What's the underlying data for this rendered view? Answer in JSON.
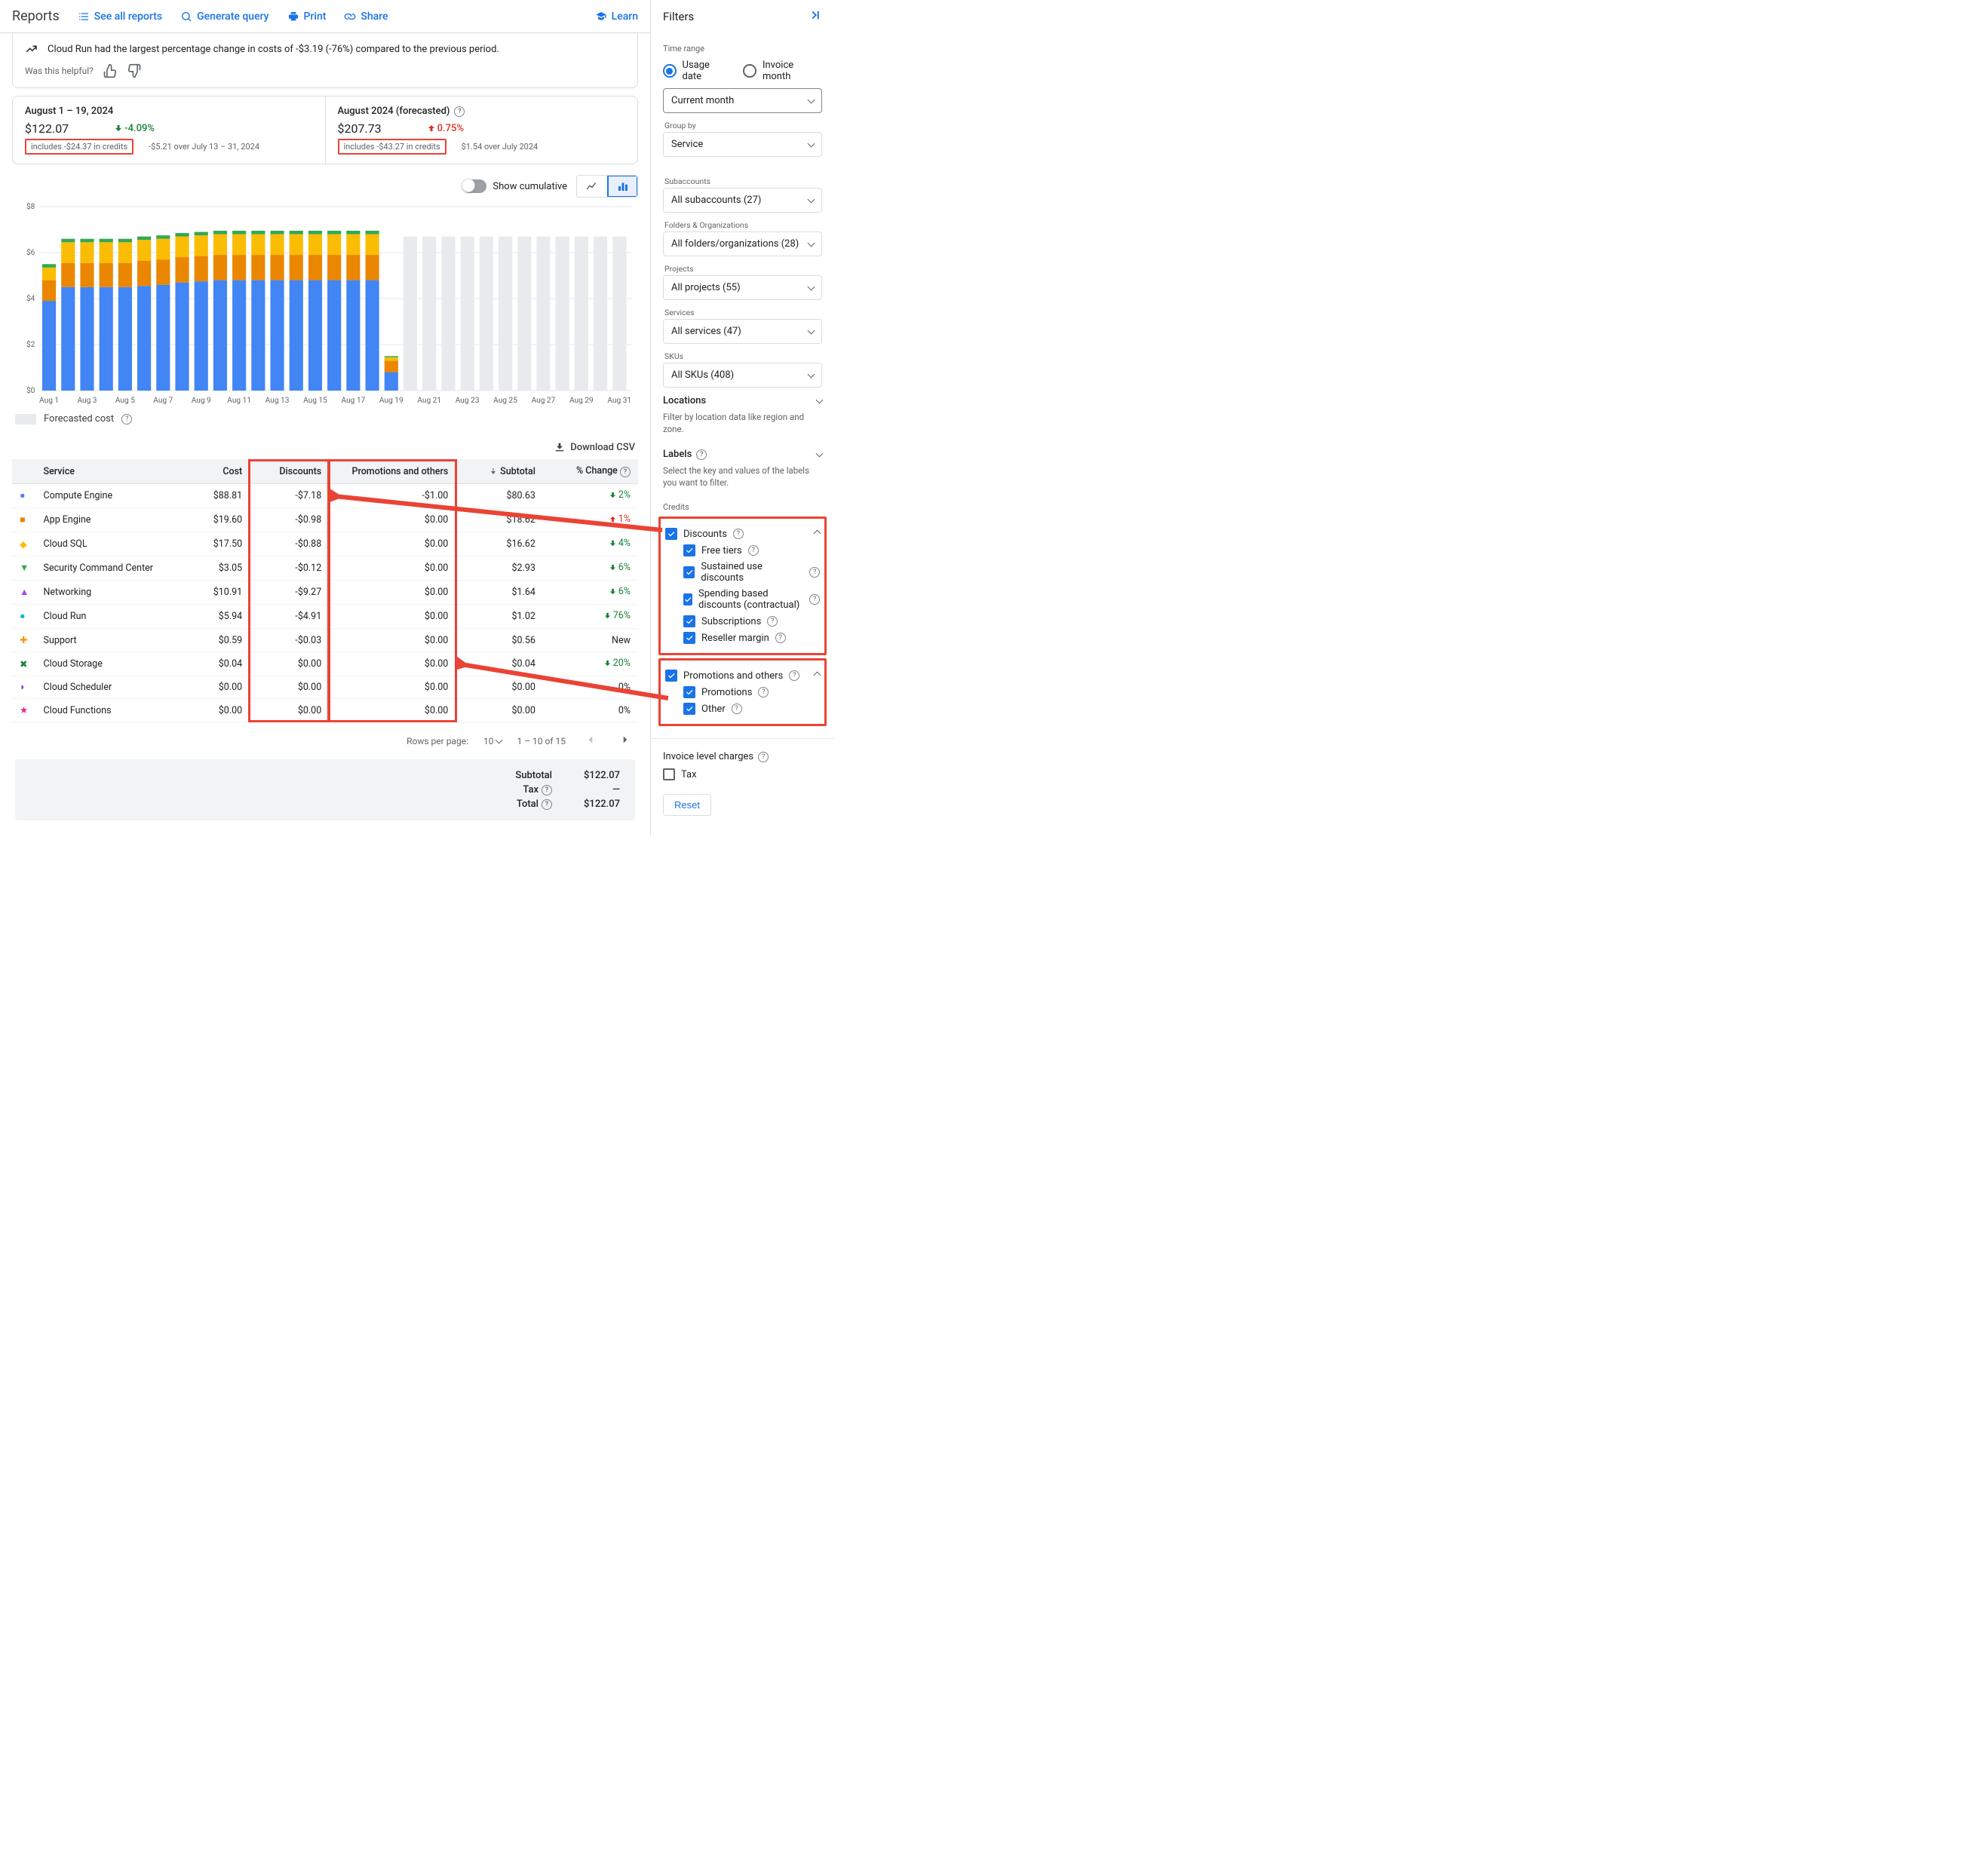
{
  "topbar": {
    "title": "Reports",
    "see_all": "See all reports",
    "gen_query": "Generate query",
    "print": "Print",
    "share": "Share",
    "learn": "Learn"
  },
  "insight": {
    "text": "Cloud Run had the largest percentage change in costs of -$3.19 (-76%) compared to the previous period.",
    "helpful": "Was this helpful?"
  },
  "summary": {
    "left": {
      "title": "August 1 – 19, 2024",
      "amount": "$122.07",
      "pct": "-4.09%",
      "pct_dir": "down",
      "pct_color": "green",
      "credits": "includes -$24.37 in credits",
      "sub": "-$5.21 over July 13 – 31, 2024"
    },
    "right": {
      "title": "August 2024 (forecasted)",
      "amount": "$207.73",
      "pct": "0.75%",
      "pct_dir": "up",
      "pct_color": "red",
      "credits": "includes -$43.27 in credits",
      "sub": "$1.54 over July 2024"
    }
  },
  "chart_controls": {
    "cumulative": "Show cumulative"
  },
  "chart_data": {
    "type": "bar",
    "ylabel": "",
    "ylim": [
      0,
      8
    ],
    "yticks": [
      "$0",
      "$2",
      "$4",
      "$6",
      "$8"
    ],
    "categories": [
      "Aug 1",
      "Aug 2",
      "Aug 3",
      "Aug 4",
      "Aug 5",
      "Aug 6",
      "Aug 7",
      "Aug 8",
      "Aug 9",
      "Aug 10",
      "Aug 11",
      "Aug 12",
      "Aug 13",
      "Aug 14",
      "Aug 15",
      "Aug 16",
      "Aug 17",
      "Aug 18",
      "Aug 19",
      "Aug 20",
      "Aug 21",
      "Aug 22",
      "Aug 23",
      "Aug 24",
      "Aug 25",
      "Aug 26",
      "Aug 27",
      "Aug 28",
      "Aug 29",
      "Aug 30",
      "Aug 31"
    ],
    "x_tick_every": 2,
    "series": [
      {
        "name": "Compute Engine",
        "color": "#4285f4",
        "values": [
          3.9,
          4.5,
          4.5,
          4.5,
          4.5,
          4.55,
          4.6,
          4.7,
          4.75,
          4.8,
          4.8,
          4.8,
          4.8,
          4.8,
          4.8,
          4.8,
          4.8,
          4.8,
          0.8,
          0,
          0,
          0,
          0,
          0,
          0,
          0,
          0,
          0,
          0,
          0,
          0
        ]
      },
      {
        "name": "App Engine",
        "color": "#ea8600",
        "values": [
          0.9,
          1.05,
          1.05,
          1.05,
          1.05,
          1.1,
          1.1,
          1.1,
          1.1,
          1.1,
          1.1,
          1.1,
          1.1,
          1.1,
          1.1,
          1.1,
          1.1,
          1.1,
          0.5,
          0,
          0,
          0,
          0,
          0,
          0,
          0,
          0,
          0,
          0,
          0,
          0
        ]
      },
      {
        "name": "Cloud SQL",
        "color": "#fbbc04",
        "values": [
          0.55,
          0.9,
          0.9,
          0.9,
          0.9,
          0.9,
          0.9,
          0.9,
          0.9,
          0.9,
          0.9,
          0.9,
          0.9,
          0.9,
          0.9,
          0.9,
          0.9,
          0.9,
          0.15,
          0,
          0,
          0,
          0,
          0,
          0,
          0,
          0,
          0,
          0,
          0,
          0
        ]
      },
      {
        "name": "Other",
        "color": "#34a853",
        "values": [
          0.15,
          0.15,
          0.15,
          0.15,
          0.15,
          0.15,
          0.15,
          0.15,
          0.15,
          0.15,
          0.15,
          0.15,
          0.15,
          0.15,
          0.15,
          0.15,
          0.15,
          0.15,
          0.05,
          0,
          0,
          0,
          0,
          0,
          0,
          0,
          0,
          0,
          0,
          0,
          0
        ]
      },
      {
        "name": "Forecasted cost",
        "color": "#e8eaed",
        "values": [
          0,
          0,
          0,
          0,
          0,
          0,
          0,
          0,
          0,
          0,
          0,
          0,
          0,
          0,
          0,
          0,
          0,
          0,
          0,
          6.7,
          6.7,
          6.7,
          6.7,
          6.7,
          6.7,
          6.7,
          6.7,
          6.7,
          6.7,
          6.7,
          6.7
        ]
      }
    ]
  },
  "legend": {
    "forecast": "Forecasted cost"
  },
  "download_csv": "Download CSV",
  "table": {
    "headers": {
      "service": "Service",
      "cost": "Cost",
      "discounts": "Discounts",
      "promotions": "Promotions and others",
      "subtotal": "Subtotal",
      "pct_change": "% Change"
    },
    "rows": [
      {
        "icon": "●",
        "color": "#4285f4",
        "service": "Compute Engine",
        "cost": "$88.81",
        "discounts": "-$7.18",
        "promotions": "-$1.00",
        "subtotal": "$80.63",
        "pct": "2%",
        "dir": "down",
        "pcolor": "green"
      },
      {
        "icon": "■",
        "color": "#ea8600",
        "service": "App Engine",
        "cost": "$19.60",
        "discounts": "-$0.98",
        "promotions": "$0.00",
        "subtotal": "$18.62",
        "pct": "1%",
        "dir": "up",
        "pcolor": "red"
      },
      {
        "icon": "◆",
        "color": "#fbbc04",
        "service": "Cloud SQL",
        "cost": "$17.50",
        "discounts": "-$0.88",
        "promotions": "$0.00",
        "subtotal": "$16.62",
        "pct": "4%",
        "dir": "down",
        "pcolor": "green"
      },
      {
        "icon": "▼",
        "color": "#34a853",
        "service": "Security Command Center",
        "cost": "$3.05",
        "discounts": "-$0.12",
        "promotions": "$0.00",
        "subtotal": "$2.93",
        "pct": "6%",
        "dir": "down",
        "pcolor": "green"
      },
      {
        "icon": "▲",
        "color": "#a142f4",
        "service": "Networking",
        "cost": "$10.91",
        "discounts": "-$9.27",
        "promotions": "$0.00",
        "subtotal": "$1.64",
        "pct": "6%",
        "dir": "down",
        "pcolor": "green"
      },
      {
        "icon": "●",
        "color": "#12b5cb",
        "service": "Cloud Run",
        "cost": "$5.94",
        "discounts": "-$4.91",
        "promotions": "$0.00",
        "subtotal": "$1.02",
        "pct": "76%",
        "dir": "down",
        "pcolor": "green"
      },
      {
        "icon": "✚",
        "color": "#f29900",
        "service": "Support",
        "cost": "$0.59",
        "discounts": "-$0.03",
        "promotions": "$0.00",
        "subtotal": "$0.56",
        "pct": "New",
        "dir": "",
        "pcolor": ""
      },
      {
        "icon": "✖",
        "color": "#188038",
        "service": "Cloud Storage",
        "cost": "$0.04",
        "discounts": "$0.00",
        "promotions": "$0.00",
        "subtotal": "$0.04",
        "pct": "20%",
        "dir": "down",
        "pcolor": "green"
      },
      {
        "icon": "◗",
        "color": "#9334e6",
        "service": "Cloud Scheduler",
        "cost": "$0.00",
        "discounts": "$0.00",
        "promotions": "$0.00",
        "subtotal": "$0.00",
        "pct": "0%",
        "dir": "",
        "pcolor": ""
      },
      {
        "icon": "★",
        "color": "#e52592",
        "service": "Cloud Functions",
        "cost": "$0.00",
        "discounts": "$0.00",
        "promotions": "$0.00",
        "subtotal": "$0.00",
        "pct": "0%",
        "dir": "",
        "pcolor": ""
      }
    ]
  },
  "pager": {
    "rows_label": "Rows per page:",
    "rows_value": "10",
    "range": "1 – 10 of 15"
  },
  "totals": {
    "subtotal_label": "Subtotal",
    "subtotal_val": "$122.07",
    "tax_label": "Tax",
    "tax_val": "—",
    "total_label": "Total",
    "total_val": "$122.07"
  },
  "filters": {
    "title": "Filters",
    "time_range": "Time range",
    "usage_date": "Usage date",
    "invoice_month": "Invoice month",
    "current_month": "Current month",
    "group_by": "Group by",
    "group_by_val": "Service",
    "subaccounts": "Subaccounts",
    "subaccounts_val": "All subaccounts (27)",
    "folders": "Folders & Organizations",
    "folders_val": "All folders/organizations (28)",
    "projects": "Projects",
    "projects_val": "All projects (55)",
    "services": "Services",
    "services_val": "All services (47)",
    "skus": "SKUs",
    "skus_val": "All SKUs (408)",
    "locations": "Locations",
    "locations_help": "Filter by location data like region and zone.",
    "labels": "Labels",
    "labels_help": "Select the key and values of the labels you want to filter.",
    "credits": "Credits",
    "discounts": "Discounts",
    "free_tiers": "Free tiers",
    "sustained": "Sustained use discounts",
    "spending": "Spending based discounts (contractual)",
    "subscriptions": "Subscriptions",
    "reseller": "Reseller margin",
    "promo_others": "Promotions and others",
    "promotions": "Promotions",
    "other": "Other",
    "invoice_charges": "Invoice level charges",
    "tax": "Tax",
    "reset": "Reset"
  }
}
